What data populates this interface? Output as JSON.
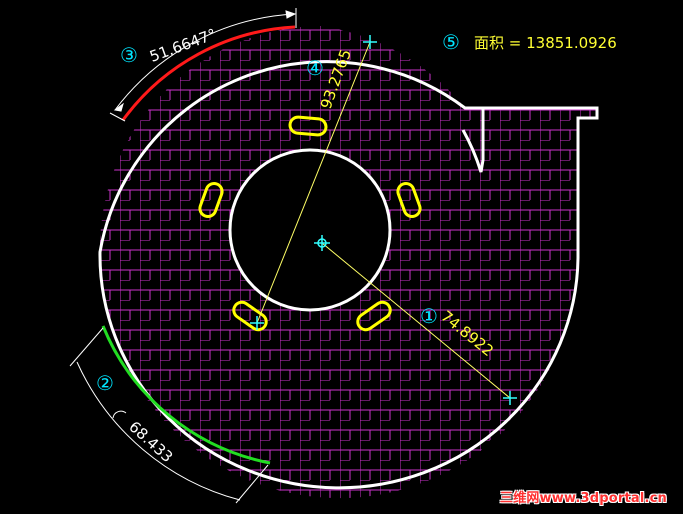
{
  "colors": {
    "background": "#000000",
    "outline": "#ffffff",
    "hatch": "#cc33cc",
    "slots": "#ffff00",
    "dimension_text": "#ffff33",
    "callout_number": "#00e5ff",
    "arc_top": "#ff1a1a",
    "arc_bottom": "#22dd22",
    "cross_marker": "#33ffff"
  },
  "callouts": {
    "c1": "①",
    "c2": "②",
    "c3": "③",
    "c4": "④",
    "c5": "⑤"
  },
  "dimensions": {
    "radius": "74.8922",
    "chord": "93.2765",
    "arc_angle": "51.6647°",
    "arc_length": "68.433"
  },
  "area_text": "面积 = 13851.0926",
  "watermark": "三维网www.3dportal.cn"
}
